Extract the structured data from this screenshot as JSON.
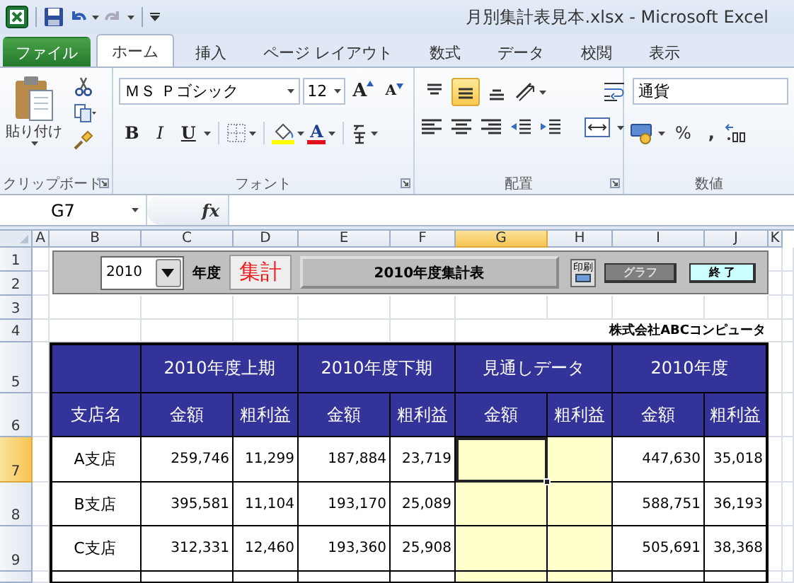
{
  "window": {
    "title": "月別集計表見本.xlsx - Microsoft Excel"
  },
  "ribbon_tabs": [
    {
      "label": "ファイル",
      "kind": "file",
      "selected": false
    },
    {
      "label": "ホーム",
      "kind": "tab",
      "selected": true
    },
    {
      "label": "挿入",
      "kind": "tab",
      "selected": false
    },
    {
      "label": "ページ レイアウト",
      "kind": "tab",
      "selected": false
    },
    {
      "label": "数式",
      "kind": "tab",
      "selected": false
    },
    {
      "label": "データ",
      "kind": "tab",
      "selected": false
    },
    {
      "label": "校閲",
      "kind": "tab",
      "selected": false
    },
    {
      "label": "表示",
      "kind": "tab",
      "selected": false
    }
  ],
  "ribbon_groups": [
    {
      "kind": "clipboard",
      "label": "クリップボード",
      "paste_label": "貼り付け"
    },
    {
      "kind": "font",
      "label": "フォント",
      "font_name": "ＭＳ Ｐゴシック",
      "font_size": "12",
      "grow_label": "A",
      "shrink_label": "A",
      "styles": [
        "B",
        "I",
        "U"
      ],
      "font_color_label": "A"
    },
    {
      "kind": "alignment",
      "label": "配置",
      "vertical": [
        {
          "selected": false
        },
        {
          "selected": true
        },
        {
          "selected": false
        }
      ]
    },
    {
      "kind": "number",
      "label": "数値",
      "format": "通貨",
      "percent": "%",
      "comma": ","
    }
  ],
  "formula_bar": {
    "name_box": "G7",
    "fx_label": "fx"
  },
  "column_headers": [
    {
      "label": "A",
      "selected": false
    },
    {
      "label": "B",
      "selected": false
    },
    {
      "label": "C",
      "selected": false
    },
    {
      "label": "D",
      "selected": false
    },
    {
      "label": "E",
      "selected": false
    },
    {
      "label": "F",
      "selected": false
    },
    {
      "label": "G",
      "selected": true
    },
    {
      "label": "H",
      "selected": false
    },
    {
      "label": "I",
      "selected": false
    },
    {
      "label": "J",
      "selected": false
    },
    {
      "label": "K",
      "selected": false
    }
  ],
  "row_headers": [
    {
      "label": "1",
      "selected": false
    },
    {
      "label": "2",
      "selected": false
    },
    {
      "label": "3",
      "selected": false
    },
    {
      "label": "4",
      "selected": false
    },
    {
      "label": "5",
      "selected": false
    },
    {
      "label": "6",
      "selected": false
    },
    {
      "label": "7",
      "selected": true
    },
    {
      "label": "8",
      "selected": false
    },
    {
      "label": "9",
      "selected": false
    }
  ],
  "control_panel": {
    "year": "2010",
    "year_label": "年度",
    "tally_button": "集計",
    "title_button": "2010年度集計表",
    "print_button": "印刷",
    "graph_button": "グラフ",
    "exit_button": "終 了"
  },
  "company": "株式会社ABCコンピュータ",
  "table": {
    "branch_header": "支店名",
    "groups": [
      {
        "label": "2010年度上期",
        "kind": "actual",
        "columns": [
          "金額",
          "粗利益"
        ]
      },
      {
        "label": "2010年度下期",
        "kind": "actual",
        "columns": [
          "金額",
          "粗利益"
        ]
      },
      {
        "label": "見通しデータ",
        "kind": "input",
        "columns": [
          "金額",
          "粗利益"
        ]
      },
      {
        "label": "2010年度",
        "kind": "actual",
        "columns": [
          "金額",
          "粗利益"
        ]
      }
    ],
    "rows": [
      {
        "branch": "A支店",
        "values": [
          [
            "259,746",
            "11,299"
          ],
          [
            "187,884",
            "23,719"
          ],
          [
            "447,630",
            "35,018"
          ]
        ]
      },
      {
        "branch": "B支店",
        "values": [
          [
            "395,581",
            "11,104"
          ],
          [
            "193,170",
            "25,089"
          ],
          [
            "588,751",
            "36,193"
          ]
        ]
      },
      {
        "branch": "C支店",
        "values": [
          [
            "312,331",
            "12,460"
          ],
          [
            "193,360",
            "25,908"
          ],
          [
            "505,691",
            "38,368"
          ]
        ]
      }
    ]
  }
}
